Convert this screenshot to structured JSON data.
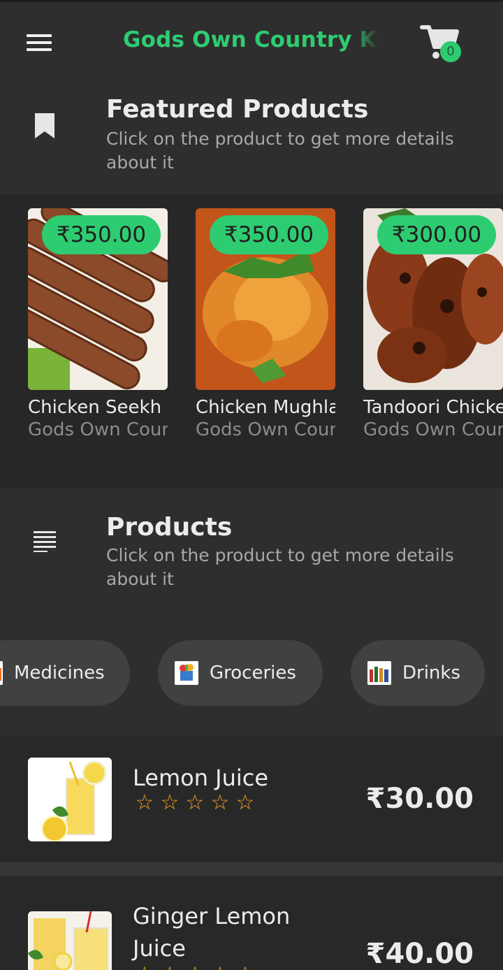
{
  "app": {
    "title": "Gods Own Country Kitchen",
    "cart_count": "0",
    "accent_color": "#2ecc71"
  },
  "featured": {
    "title": "Featured Products",
    "subtitle": "Click on the product to get more details about it",
    "icon": "bookmark-icon",
    "items": [
      {
        "price": "₹350.00",
        "name": "Chicken Seekh Kebab",
        "vendor": "Gods Own Country Kitchen"
      },
      {
        "price": "₹350.00",
        "name": "Chicken Mughlai",
        "vendor": "Gods Own Country Kitchen"
      },
      {
        "price": "₹300.00",
        "name": "Tandoori Chicken",
        "vendor": "Gods Own Country Kitchen"
      }
    ]
  },
  "products": {
    "title": "Products",
    "subtitle": "Click on the product to get more details about it",
    "icon": "list-icon",
    "categories": [
      {
        "label": "Medicines"
      },
      {
        "label": "Groceries"
      },
      {
        "label": "Drinks"
      }
    ],
    "items": [
      {
        "name": "Lemon Juice",
        "price": "₹30.00",
        "rating": 0,
        "stars": "☆☆☆☆☆"
      },
      {
        "name": "Ginger Lemon Juice",
        "price": "₹40.00",
        "rating": 0,
        "stars": "☆☆☆☆☆"
      }
    ]
  }
}
